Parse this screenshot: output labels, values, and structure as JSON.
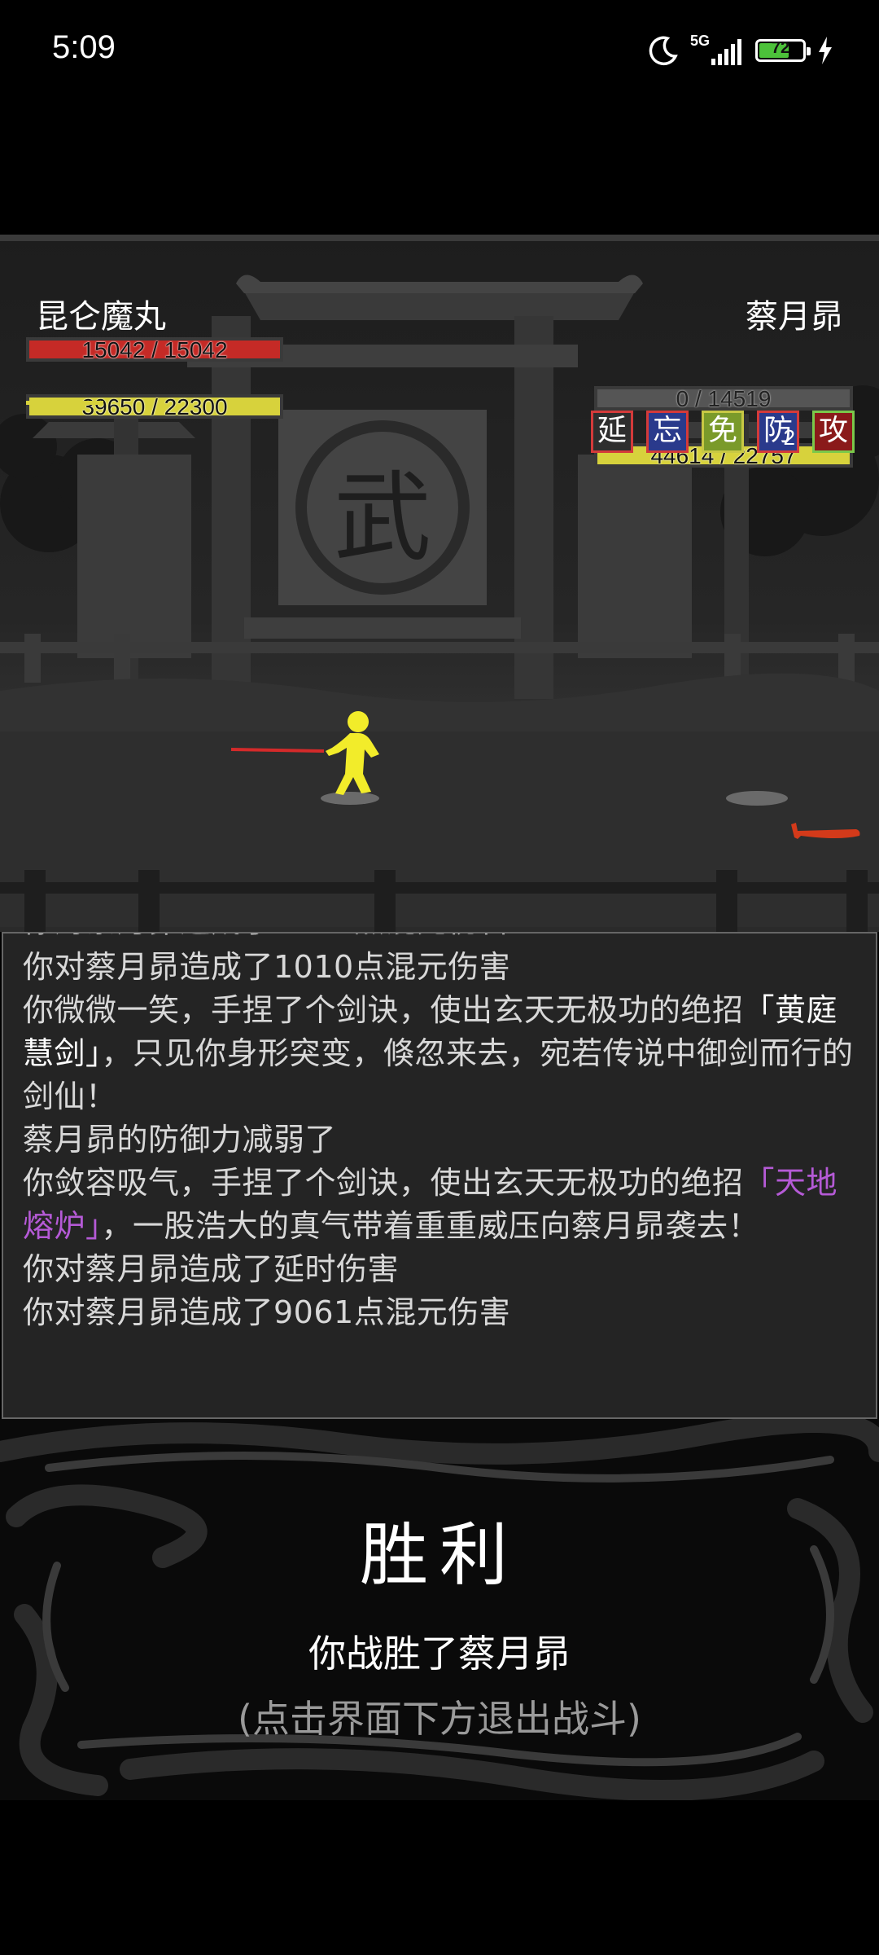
{
  "status_bar": {
    "time": "5:09",
    "network": "5G",
    "battery": "72",
    "battery_level": 0.72
  },
  "player": {
    "name": "昆仑魔丸",
    "hp_text": "15042 / 15042",
    "hp_fraction": 1.0,
    "mp_text": "39650 / 22300",
    "mp_fraction": 1.0,
    "extra_gauge_fraction": 0.3
  },
  "enemy": {
    "name": "蔡月昴",
    "hp_text": "0 / 14519",
    "hp_fraction": 0.0,
    "mp_text": "44614 / 22757",
    "mp_fraction": 1.0,
    "status_icons": [
      {
        "label": "延",
        "bg": "#2e2e2e",
        "border": "#d43a3a",
        "count": ""
      },
      {
        "label": "忘",
        "bg": "#2a3a8c",
        "border": "#d43a3a",
        "count": ""
      },
      {
        "label": "免",
        "bg": "#7a9a2a",
        "border": "#c8c844",
        "count": ""
      },
      {
        "label": "防",
        "bg": "#2a3a8c",
        "border": "#d43a3a",
        "count": "2"
      },
      {
        "label": "攻",
        "bg": "#8a1a1a",
        "border": "#7ac84a",
        "count": ""
      }
    ]
  },
  "scene": {
    "banner_char": "武"
  },
  "log": {
    "cut_line": "你对蔡月昴造成了1010点混元伤害",
    "line1": "你对蔡月昴造成了1010点混元伤害",
    "line2_pre": "你微微一笑，手捏了个剑诀，使出玄天无极功的绝招",
    "line2_move": "「黄庭慧剑」",
    "line2_post": "，只见你身形突变，倏忽来去，宛若传说中御剑而行的剑仙！",
    "line3": "蔡月昴的防御力减弱了",
    "line4_pre": "你敛容吸气，手捏了个剑诀，使出玄天无极功的绝招",
    "line4_move": "「天地熔炉」",
    "line4_post": "，一股浩大的真气带着重重威压向蔡月昴袭去！",
    "line5": "你对蔡月昴造成了延时伤害",
    "line6": "你对蔡月昴造成了9061点混元伤害"
  },
  "result": {
    "title": "胜利",
    "message": "你战胜了蔡月昴",
    "hint": "(点击界面下方退出战斗)"
  }
}
